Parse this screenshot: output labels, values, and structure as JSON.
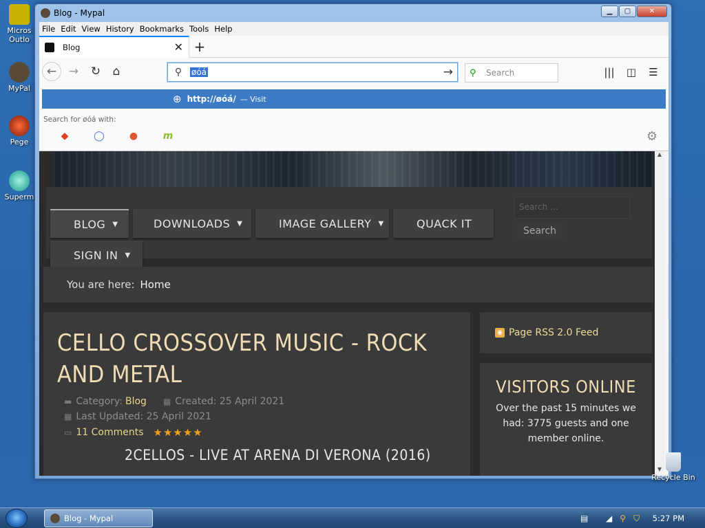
{
  "desktop": {
    "icons": [
      {
        "label": "Micros\nOutlo"
      },
      {
        "label": "MyPal"
      },
      {
        "label": "Pege"
      },
      {
        "label": "Superm"
      }
    ],
    "recycle_bin": "Recycle Bin"
  },
  "window": {
    "title": "Blog - Mypal"
  },
  "menubar": [
    "File",
    "Edit",
    "View",
    "History",
    "Bookmarks",
    "Tools",
    "Help"
  ],
  "tab": {
    "title": "Blog"
  },
  "urlbar": {
    "value": "øóá"
  },
  "searchbar": {
    "placeholder": "Search"
  },
  "dropdown": {
    "url": "http://øóá/",
    "visit": "— Visit",
    "search_for": "Search for øóá with:",
    "engines": [
      "brave-engine",
      "qwant-engine",
      "duckduckgo-engine",
      "mojeek-engine"
    ]
  },
  "site": {
    "nav": [
      "BLOG",
      "DOWNLOADS",
      "IMAGE GALLERY",
      "QUACK IT",
      "SIGN IN"
    ],
    "search_placeholder": "Search ...",
    "search_button": "Search",
    "breadcrumb_prefix": "You are here:",
    "breadcrumb_home": "Home",
    "article": {
      "title": "CELLO CROSSOVER MUSIC - ROCK AND METAL",
      "category_label": "Category:",
      "category": "Blog",
      "created": "Created: 25 April 2021",
      "updated": "Last Updated: 25 April 2021",
      "comments": "11 Comments",
      "stars": "★★★★★",
      "video_title": "2CELLOS - LIVE AT ARENA DI VERONA (2016)"
    },
    "rss": "Page RSS 2.0 Feed",
    "visitors": {
      "heading": "VISITORS ONLINE",
      "body": "Over the past 15 minutes we had: 3775 guests and one member online."
    }
  },
  "taskbar": {
    "task_label": "Blog - Mypal",
    "clock": "5:27 PM"
  }
}
